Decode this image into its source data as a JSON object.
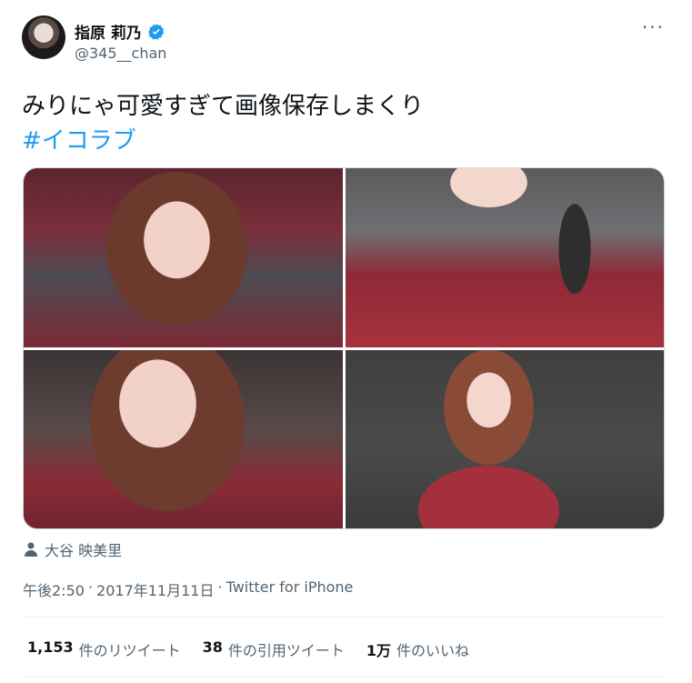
{
  "author": {
    "display_name": "指原 莉乃",
    "handle": "@345__chan"
  },
  "tweet": {
    "text": "みりにゃ可愛すぎて画像保存しまくり",
    "hashtag": "#イコラブ"
  },
  "media": {
    "photo_count": 4
  },
  "tagged_person": "大谷 映美里",
  "meta": {
    "time": "午後2:50",
    "separator1": "·",
    "date": "2017年11月11日",
    "separator2": "·",
    "source": "Twitter for iPhone"
  },
  "stats": {
    "retweets": {
      "count": "1,153",
      "label": "件のリツイート"
    },
    "quotes": {
      "count": "38",
      "label": "件の引用ツイート"
    },
    "likes": {
      "count": "1万",
      "label": "件のいいね"
    }
  },
  "colors": {
    "accent": "#1d9bf0",
    "secondary_text": "#536471",
    "primary_text": "#0f1419"
  },
  "icons": {
    "more": "more-options-icon",
    "verified": "verified-badge-icon",
    "person": "person-tag-icon"
  }
}
